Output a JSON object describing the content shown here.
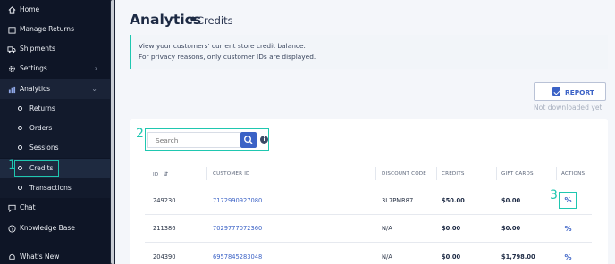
{
  "sidebar": {
    "items": [
      {
        "label": "Home",
        "icon": "home-icon"
      },
      {
        "label": "Manage Returns",
        "icon": "returns-icon"
      },
      {
        "label": "Shipments",
        "icon": "truck-icon"
      },
      {
        "label": "Settings",
        "icon": "gear-icon"
      },
      {
        "label": "Analytics",
        "icon": "chart-icon"
      },
      {
        "label": "Chat",
        "icon": "chat-icon"
      },
      {
        "label": "Knowledge Base",
        "icon": "help-icon"
      },
      {
        "label": "What's New",
        "icon": "bell-icon"
      }
    ],
    "analytics_sub": [
      "Returns",
      "Orders",
      "Sessions",
      "Credits",
      "Transactions"
    ]
  },
  "annotations": [
    "1",
    "2",
    "3"
  ],
  "header": {
    "title": "Analytics",
    "separator": "•",
    "subtitle": "Credits"
  },
  "info": {
    "line1": "View your customers' current store credit balance.",
    "line2": "For privacy reasons, only customer IDs are displayed."
  },
  "report": {
    "label": "REPORT",
    "status": "Not downloaded yet"
  },
  "search": {
    "placeholder": "Search",
    "info": "i"
  },
  "table": {
    "headers": [
      "ID",
      "CUSTOMER ID",
      "DISCOUNT CODE",
      "CREDITS",
      "GIFT CARDS",
      "ACTIONS"
    ],
    "rows": [
      {
        "id": "249230",
        "customer_id": "7172990927080",
        "discount": "3L7PMR87",
        "credits": "$50.00",
        "gift": "$0.00",
        "action": "%"
      },
      {
        "id": "211386",
        "customer_id": "7029777072360",
        "discount": "N/A",
        "credits": "$0.00",
        "gift": "$0.00",
        "action": "%"
      },
      {
        "id": "204390",
        "customer_id": "6957845283048",
        "discount": "N/A",
        "credits": "$0.00",
        "gift": "$1,798.00",
        "action": "%"
      }
    ]
  },
  "colors": {
    "accent": "#1fc7b0",
    "primary": "#3b62c6",
    "sidebar": "#0e1526"
  }
}
